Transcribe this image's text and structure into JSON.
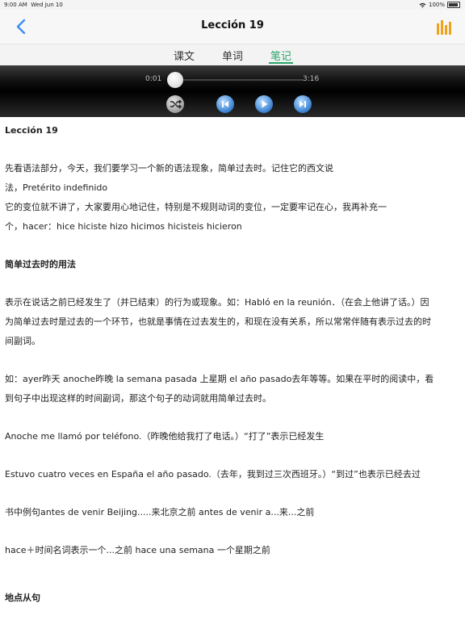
{
  "status_bar": {
    "time": "9:00 AM",
    "date": "Wed Jun 10",
    "battery": "100%"
  },
  "nav": {
    "title": "Lección 19",
    "back_icon": "chevron-left-icon",
    "stats_icon": "bar-chart-icon",
    "accent": "#f0a21a",
    "back_color": "#3b8cf5"
  },
  "tabs": {
    "items": [
      "课文",
      "单词",
      "笔记"
    ],
    "active_index": 2,
    "active_color": "#2aa46a"
  },
  "player": {
    "current": "0:01",
    "duration": "3:16",
    "progress": 0.005
  },
  "notes": {
    "heading": "Lección 19",
    "p1_l1": "先看语法部分，今天，我们要学习一个新的语法现象，简单过去时。记住它的西文说",
    "p1_l2": "法，Pretérito indefinido",
    "p1_l3": "它的变位就不讲了，大家要用心地记住，特别是不规则动词的变位，一定要牢记在心，我再补充一",
    "p1_l4": "个，hacer：hice hiciste hizo hicimos hicisteis hicieron",
    "h2": "简单过去时的用法",
    "p2_l1": "表示在说话之前已经发生了（并已结束）的行为或现象。如：Habló en la reunión．（在会上他讲了话。）因",
    "p2_l2": "为简单过去时是过去的一个环节，也就是事情在过去发生的，和现在没有关系，所以常常伴随有表示过去的时",
    "p2_l3": "间副词。",
    "p3_l1": "如：ayer昨天 anoche昨晚 la semana pasada 上星期 el año pasado去年等等。如果在平时的阅读中，看",
    "p3_l2": "到句子中出现这样的时间副词，那这个句子的动词就用简单过去时。",
    "p4": "Anoche me llamó por teléfono.（昨晚他给我打了电话。）“打了”表示已经发生",
    "p5": "Estuvo cuatro veces en España el año pasado.（去年，我到过三次西班牙。）“到过”也表示已经去过",
    "p6": "书中例句antes de venir Beijing.....来北京之前 antes de venir a...来...之前",
    "p7": "hace＋时间名词表示一个...之前 hace una semana 一个星期之前",
    "h3": "地点从句"
  }
}
